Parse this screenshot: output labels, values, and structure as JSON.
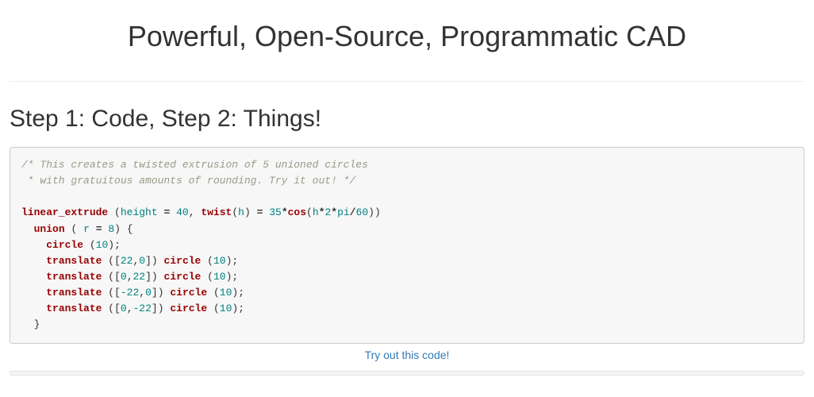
{
  "hero": {
    "title": "Powerful, Open-Source, Programmatic CAD"
  },
  "section": {
    "heading": "Step 1: Code, Step 2: Things!"
  },
  "code": {
    "comment_1": "/* This creates a twisted extrusion of 5 unioned circles",
    "comment_2": " * with gratuitous amounts of rounding. Try it out! */",
    "fn_linear_extrude": "linear_extrude",
    "var_height": "height",
    "eq": "=",
    "num_40": "40",
    "fn_twist": "twist",
    "var_h": "h",
    "num_35": "35",
    "star": "*",
    "fn_cos": "cos",
    "var_pi": "pi",
    "num_2": "2",
    "num_60": "60",
    "slash": "/",
    "fn_union": "union",
    "var_r": "r",
    "num_8": "8",
    "fn_circle": "circle",
    "num_10": "10",
    "fn_translate": "translate",
    "num_22": "22",
    "num_0": "0",
    "num_m22": "-22"
  },
  "actions": {
    "try_link": "Try out this code!"
  }
}
